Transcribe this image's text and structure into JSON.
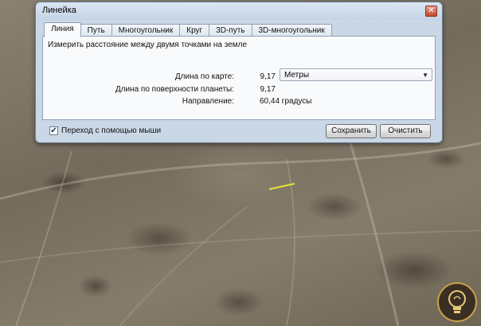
{
  "window": {
    "title": "Линейка",
    "close_glyph": "✕"
  },
  "tabs": [
    {
      "label": "Линия",
      "active": true
    },
    {
      "label": "Путь"
    },
    {
      "label": "Многоугольник"
    },
    {
      "label": "Круг"
    },
    {
      "label": "3D-путь"
    },
    {
      "label": "3D-многоугольник"
    }
  ],
  "panel": {
    "description": "Измерить расстояние между двумя точками на земле",
    "map_length_label": "Длина по карте:",
    "map_length_value": "9,17",
    "unit_selected": "Метры",
    "surface_length_label": "Длина по поверхности планеты:",
    "surface_length_value": "9,17",
    "direction_label": "Направление:",
    "direction_value": "60,44 градусы"
  },
  "footer": {
    "mouse_nav_label": "Переход с помощью мыши",
    "mouse_nav_checked": true,
    "save_label": "Сохранить",
    "clear_label": "Очистить"
  },
  "colors": {
    "measure_line": "#e8e23a",
    "dialog_bg": "#c9d7e6"
  },
  "icons": {
    "checkbox": "checkmark-icon",
    "dropdown": "chevron-down-icon",
    "logo": "lightbulb-icon"
  }
}
